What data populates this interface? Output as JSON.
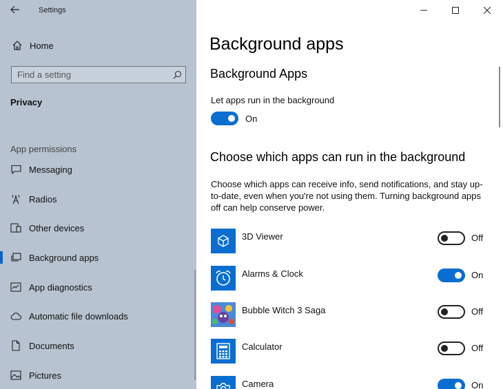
{
  "window": {
    "app_title": "Settings"
  },
  "sidebar": {
    "home_label": "Home",
    "search_placeholder": "Find a setting",
    "section_title": "Privacy",
    "group_label": "App permissions",
    "items": [
      {
        "label": "Messaging",
        "icon": "message-icon"
      },
      {
        "label": "Radios",
        "icon": "radio-tower-icon"
      },
      {
        "label": "Other devices",
        "icon": "devices-icon"
      },
      {
        "label": "Background apps",
        "icon": "background-apps-icon",
        "selected": true
      },
      {
        "label": "App diagnostics",
        "icon": "diagnostics-icon"
      },
      {
        "label": "Automatic file downloads",
        "icon": "cloud-icon"
      },
      {
        "label": "Documents",
        "icon": "document-icon"
      },
      {
        "label": "Pictures",
        "icon": "picture-icon"
      }
    ]
  },
  "content": {
    "page_title": "Background apps",
    "section1_title": "Background Apps",
    "master_toggle": {
      "label": "Let apps run in the background",
      "state": "On"
    },
    "section2_title": "Choose which apps can run in the background",
    "description": "Choose which apps can receive info, send notifications, and stay up-to-date, even when you're not using them. Turning background apps off can help conserve power.",
    "apps": [
      {
        "name": "3D Viewer",
        "state": "Off",
        "icon": "cube-icon"
      },
      {
        "name": "Alarms & Clock",
        "state": "On",
        "icon": "alarm-clock-icon"
      },
      {
        "name": "Bubble Witch 3 Saga",
        "state": "Off",
        "icon": "bubble-witch-icon"
      },
      {
        "name": "Calculator",
        "state": "Off",
        "icon": "calculator-icon"
      },
      {
        "name": "Camera",
        "state": "On",
        "icon": "camera-icon"
      }
    ]
  },
  "colors": {
    "accent": "#0a6ed1",
    "sidebar_bg": "#b7c3d0"
  }
}
